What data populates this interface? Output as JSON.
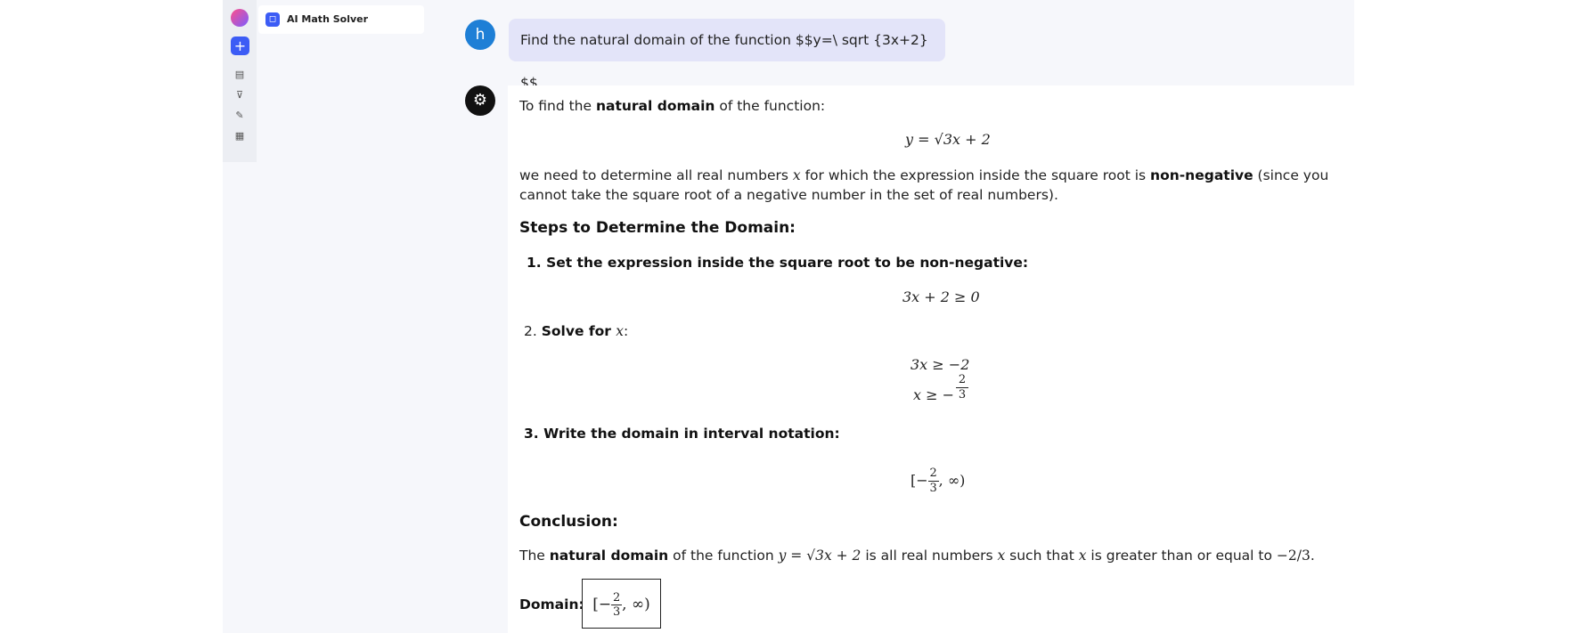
{
  "app": {
    "tool_name": "AI Math Solver",
    "new_chat_icon": "plus-icon"
  },
  "sidebar": {
    "icons": [
      "document-icon",
      "cart-icon",
      "pen-icon",
      "grid-icon"
    ]
  },
  "user": {
    "avatar_letter": "h",
    "message": "Find the natural domain of the function $$y=\\ sqrt {3x+2} $$"
  },
  "answer": {
    "intro_pre": "To find the ",
    "intro_bold": "natural domain",
    "intro_post": " of the function:",
    "formula_main": "y = √3x + 2",
    "explain_line1_pre": "we need to determine all real numbers ",
    "explain_var": "x",
    "explain_line1_mid": " for which the expression inside the square root is ",
    "explain_bold": "non-negative",
    "explain_line1_post": " (since you",
    "explain_line2": "cannot take the square root of a negative number in the set of real numbers).",
    "steps_heading": "Steps to Determine the Domain:",
    "step1": "1. Set the expression inside the square root to be non-negative:",
    "step1_formula": "3x + 2 ≥ 0",
    "step2_pre": "2. ",
    "step2_bold": "Solve for ",
    "step2_var": "x",
    "step2_post": ":",
    "step2_formula_a": "3x ≥ −2",
    "step2_formula_b": "x ≥ −",
    "frac_num": "2",
    "frac_den": "3",
    "step3": "3. Write the domain in interval notation:",
    "step3_formula_pre": "[−",
    "step3_formula_post": ", ∞)",
    "conclusion_heading": "Conclusion:",
    "conclusion_pre": "The ",
    "conclusion_bold": "natural domain",
    "conclusion_mid": " of the function ",
    "conclusion_formula": "y = √3x + 2",
    "conclusion_mid2": " is all real numbers ",
    "conclusion_var": "x",
    "conclusion_mid3": " such that ",
    "conclusion_var2": "x",
    "conclusion_post": " is greater than or equal to ",
    "conclusion_frac": "−2/3",
    "conclusion_end": ".",
    "domain_label": "Domain:",
    "domain_value_pre": "[−",
    "domain_value_post": ", ∞)"
  }
}
